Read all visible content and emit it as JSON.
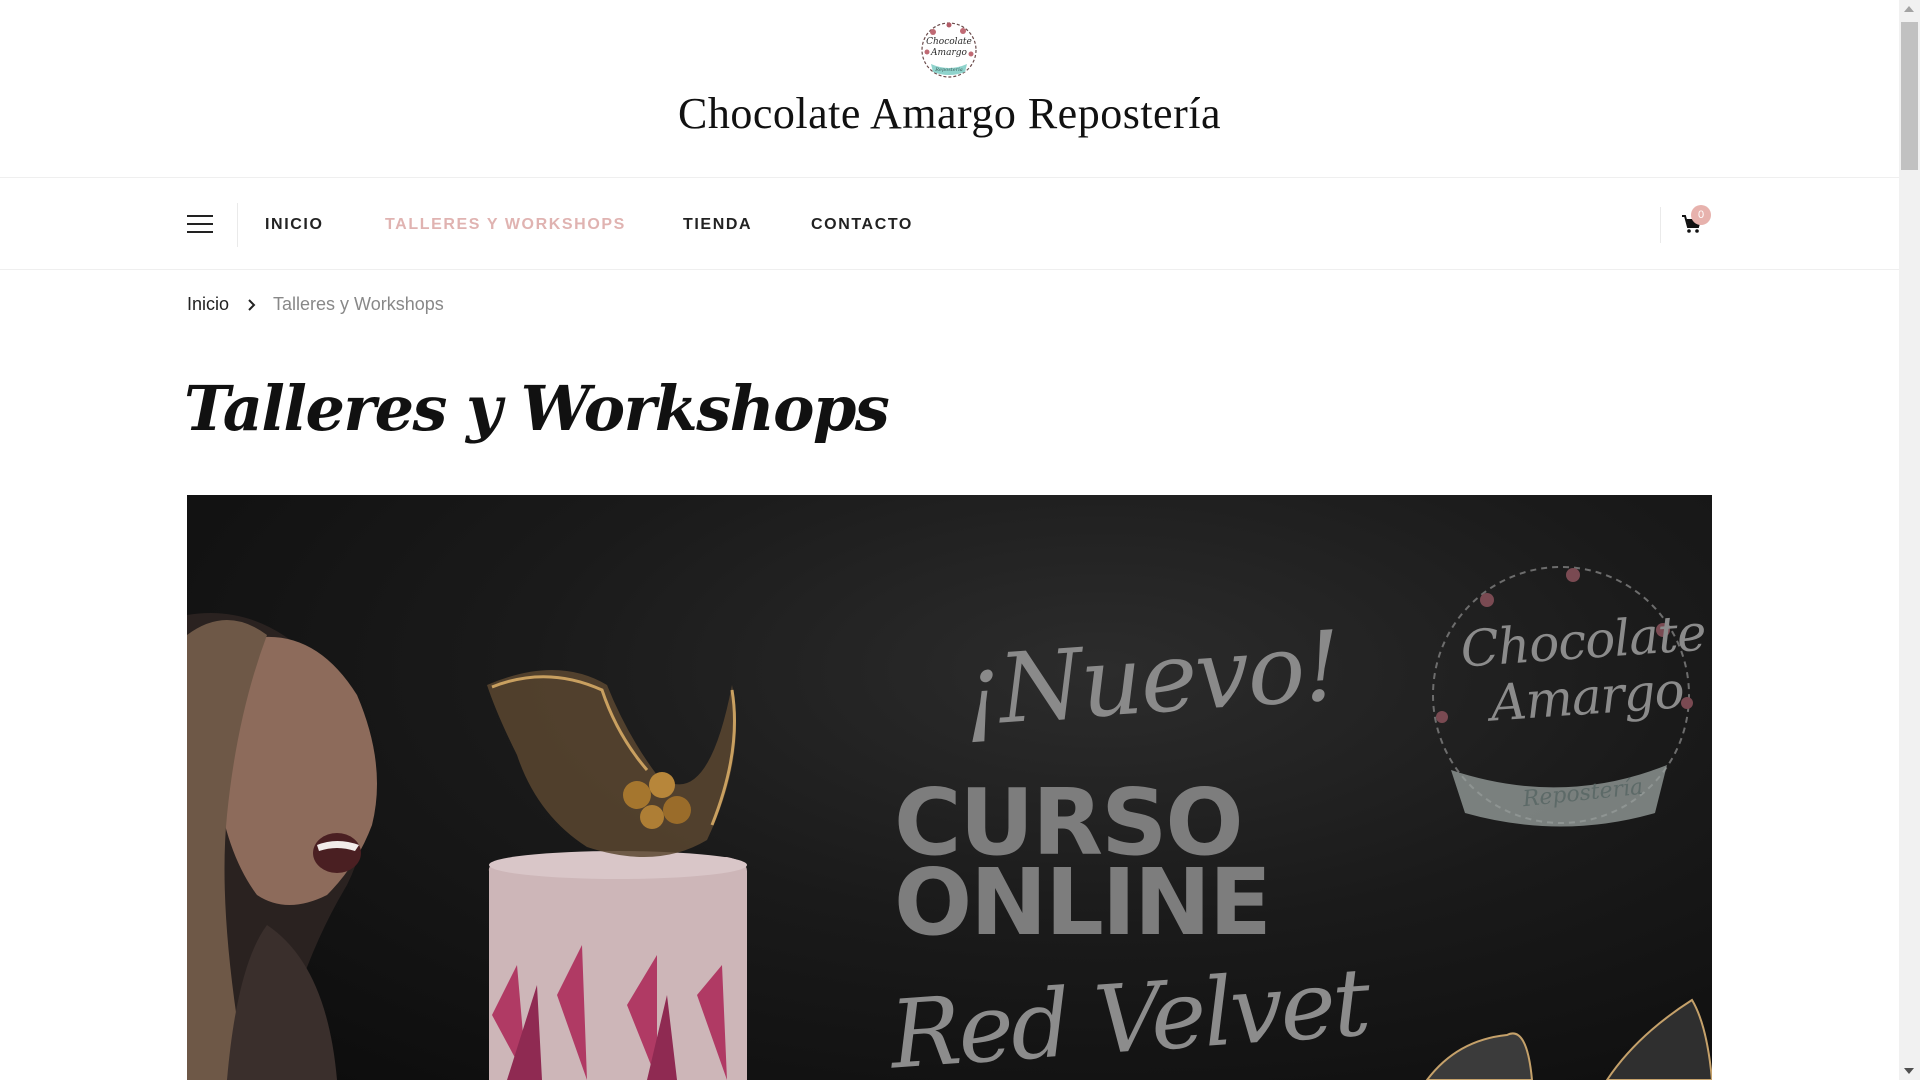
{
  "header": {
    "logo": {
      "icon": "bakery-logo-badge",
      "text_line1": "Chocolate",
      "text_line2": "Amargo",
      "ribbon": "Repostería"
    },
    "site_title": "Chocolate Amargo Repostería"
  },
  "nav": {
    "menu_icon": "hamburger-icon",
    "items": [
      {
        "label": "INICIO",
        "active": false
      },
      {
        "label": "TALLERES Y WORKSHOPS",
        "active": true
      },
      {
        "label": "TIENDA",
        "active": false
      },
      {
        "label": "CONTACTO",
        "active": false
      }
    ],
    "active_color": "#e0b3b1",
    "cart": {
      "icon": "shopping-cart-icon",
      "count": "0",
      "badge_color": "#e7b2ad"
    }
  },
  "breadcrumb": {
    "home": "Inicio",
    "separator_icon": "chevron-right-icon",
    "current": "Talleres y Workshops"
  },
  "page": {
    "title": "Talleres y Workshops"
  },
  "banner": {
    "headline": "¡Nuevo!",
    "course_line1": "CURSO",
    "course_line2": "ONLINE",
    "flavor": "Red Velvet",
    "logo_line1": "Chocolate",
    "logo_line2": "Amargo",
    "logo_ribbon": "Repostería"
  }
}
